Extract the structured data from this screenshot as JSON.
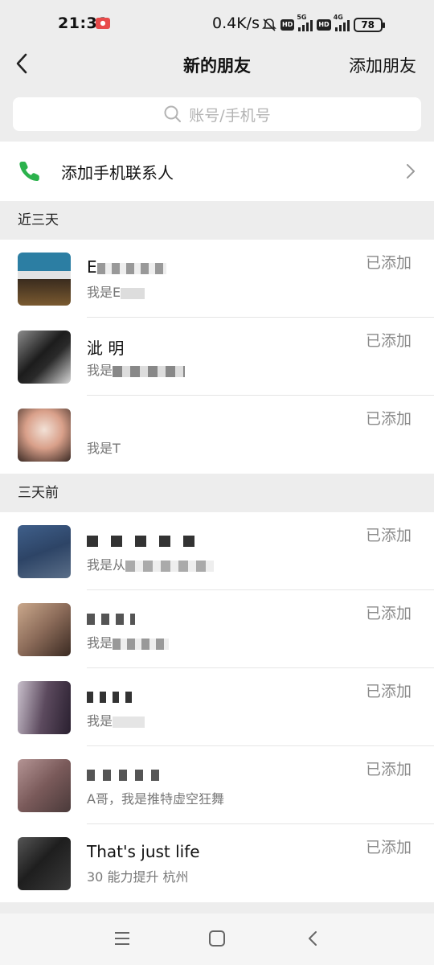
{
  "status": {
    "time": "21:31",
    "speed": "0.4K/s",
    "net1": "5G",
    "net2": "4G",
    "battery": "78",
    "hd": "HD"
  },
  "nav": {
    "title": "新的朋友",
    "action": "添加朋友"
  },
  "search": {
    "placeholder": "账号/手机号"
  },
  "phone_contacts": {
    "label": "添加手机联系人"
  },
  "sections": [
    {
      "header": "近三天",
      "friends": [
        {
          "name": "E",
          "msg": "我是E",
          "status": "已添加",
          "avatar_colors": [
            "#2c7ea3",
            "#3a2b1e"
          ]
        },
        {
          "name": "泚        明",
          "msg": "我是",
          "status": "已添加",
          "avatar_colors": [
            "#1c1c1c",
            "#8c8c8c"
          ]
        },
        {
          "name": "",
          "msg": "我是T",
          "status": "已添加",
          "avatar_colors": [
            "#d9a08a",
            "#f2e1d6"
          ]
        }
      ]
    },
    {
      "header": "三天前",
      "friends": [
        {
          "name": "",
          "msg": "我是从",
          "status": "已添加",
          "avatar_colors": [
            "#3f5f8a",
            "#5a6e88"
          ]
        },
        {
          "name": "",
          "msg": "我是",
          "status": "已添加",
          "avatar_colors": [
            "#8a6a58",
            "#caa88c"
          ]
        },
        {
          "name": "",
          "msg": "我是",
          "status": "已添加",
          "avatar_colors": [
            "#5c4a5e",
            "#c9c0cc"
          ]
        },
        {
          "name": "",
          "msg": "A哥，我是推特虚空狂舞",
          "status": "已添加",
          "avatar_colors": [
            "#7a5a5a",
            "#b49494"
          ]
        },
        {
          "name": "That's just life",
          "msg": "30 能力提升 杭州",
          "status": "已添加",
          "avatar_colors": [
            "#1e1e1e",
            "#555555"
          ]
        }
      ]
    }
  ]
}
